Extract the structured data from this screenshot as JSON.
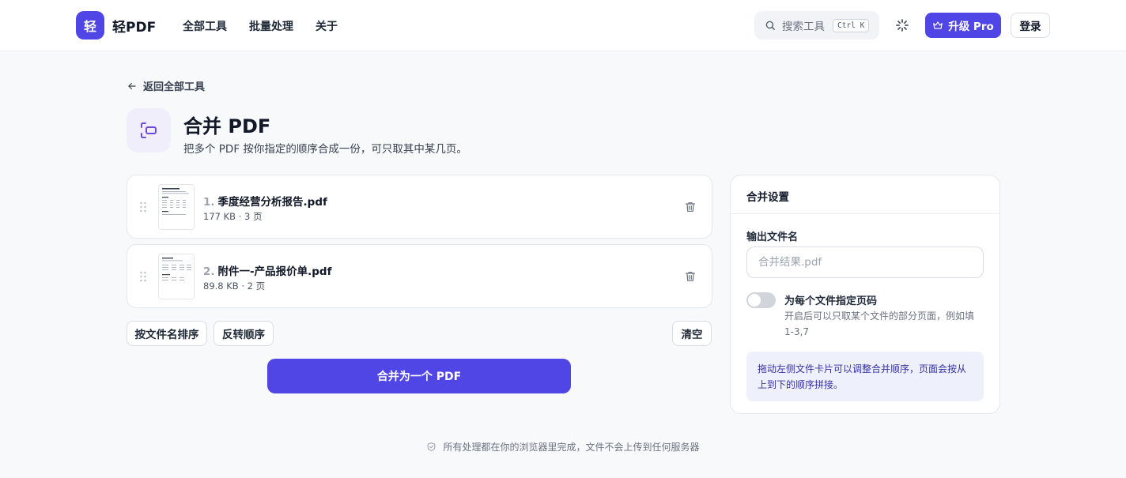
{
  "header": {
    "logo_char": "轻",
    "brand": "轻PDF",
    "nav": [
      "全部工具",
      "批量处理",
      "关于"
    ],
    "search_label": "搜索工具",
    "search_kbd": "Ctrl K",
    "pro_label": "升级 Pro",
    "login_label": "登录"
  },
  "back_label": "返回全部工具",
  "tool": {
    "title": "合并 PDF",
    "subtitle": "把多个 PDF 按你指定的顺序合成一份，可只取其中某几页。"
  },
  "files": [
    {
      "index": "1.",
      "name": "季度经营分析报告.pdf",
      "meta": "177 KB · 3 页"
    },
    {
      "index": "2.",
      "name": "附件一-产品报价单.pdf",
      "meta": "89.8 KB · 2 页"
    }
  ],
  "actions": {
    "sort_by_name": "按文件名排序",
    "reverse": "反转顺序",
    "clear": "清空",
    "merge": "合并为一个 PDF"
  },
  "settings": {
    "title": "合并设置",
    "output_label": "输出文件名",
    "output_placeholder": "合并结果.pdf",
    "toggle_label": "为每个文件指定页码",
    "toggle_on": false,
    "toggle_help": "开启后可以只取某个文件的部分页面，例如填 1-3,7",
    "tip": "拖动左侧文件卡片可以调整合并顺序，页面会按从上到下的顺序拼接。"
  },
  "footer_text": "所有处理都在你的浏览器里完成，文件不会上传到任何服务器",
  "colors": {
    "accent": "#4f46e5",
    "tip_bg": "#eef0fc"
  }
}
